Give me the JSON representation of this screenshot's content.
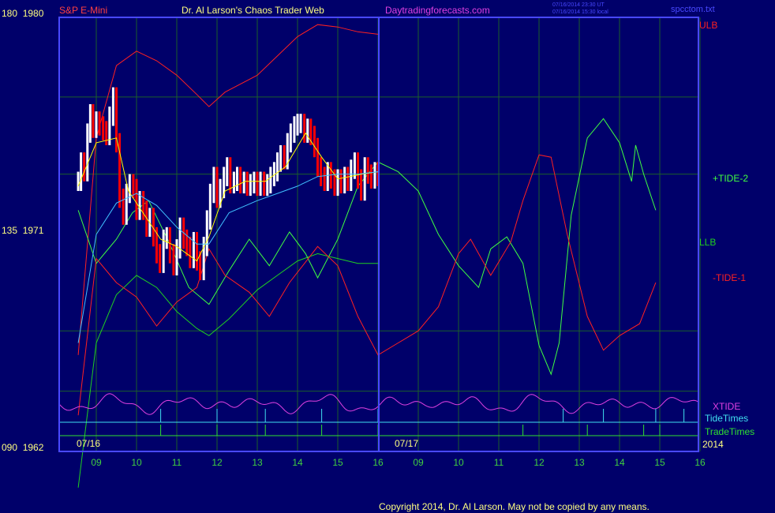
{
  "header": {
    "symbol": "S&P E-Mini",
    "site_title": "Dr. Al Larson's Chaos Trader Web",
    "site_link": "Daytradingforecasts.com",
    "timestamp_ut": "07/16/2014 23:30 UT",
    "timestamp_local": "07/16/2014 15:30 local",
    "file_name": "spcctom.txt"
  },
  "y_axis": {
    "top_label": "180  1980",
    "mid_label": "135  1971",
    "bottom_label": "090  1962"
  },
  "footer": {
    "date_left": "07/16",
    "date_mid": "07/17",
    "year": "2014",
    "copyright": "Copyright 2014, Dr. Al Larson. May not be copied by any means."
  },
  "legend": {
    "ulb": "ULB",
    "tide2": "+TIDE-2",
    "llb": "LLB",
    "tide1": "-TIDE-1",
    "xtide": "XTIDE",
    "tidetimes": "TideTimes",
    "tradetimes": "TradeTimes"
  },
  "colors": {
    "background": "#00006a",
    "frame": "#4848ff",
    "grid": "#1b5e2b",
    "price_up": "#ffffff",
    "price_down": "#ff0000",
    "ulb": "#ff2020",
    "llb": "#20d020",
    "tide2": "#40ff40",
    "tide1": "#ff2020",
    "xtide": "#e040e0",
    "tidetimes": "#40e0f0",
    "tradetimes": "#30e030",
    "ma_fast": "#ffff00",
    "ma_slow": "#40c0ff",
    "label_yellow": "#ffff80",
    "hour_labels": "#40d040",
    "title_blue": "#8080ff"
  },
  "chart_data": {
    "type": "line",
    "x_unit": "hour (Eastern)",
    "x_ticks": [
      {
        "day": "07/16",
        "hour": 9,
        "label": "09"
      },
      {
        "day": "07/16",
        "hour": 10,
        "label": "10"
      },
      {
        "day": "07/16",
        "hour": 11,
        "label": "11"
      },
      {
        "day": "07/16",
        "hour": 12,
        "label": "12"
      },
      {
        "day": "07/16",
        "hour": 13,
        "label": "13"
      },
      {
        "day": "07/16",
        "hour": 14,
        "label": "14"
      },
      {
        "day": "07/16",
        "hour": 15,
        "label": "15"
      },
      {
        "day": "07/16",
        "hour": 16,
        "label": "16"
      },
      {
        "day": "07/17",
        "hour": 9,
        "label": "09"
      },
      {
        "day": "07/17",
        "hour": 10,
        "label": "10"
      },
      {
        "day": "07/17",
        "hour": 11,
        "label": "11"
      },
      {
        "day": "07/17",
        "hour": 12,
        "label": "12"
      },
      {
        "day": "07/17",
        "hour": 13,
        "label": "13"
      },
      {
        "day": "07/17",
        "hour": 14,
        "label": "14"
      },
      {
        "day": "07/17",
        "hour": 15,
        "label": "15"
      },
      {
        "day": "07/17",
        "hour": 16,
        "label": "16"
      }
    ],
    "y_range": [
      1962,
      1980
    ],
    "y_ticks": [
      1962,
      1971,
      1980
    ],
    "price_bars": [
      [
        8.55,
        1973.2
      ],
      [
        8.62,
        1974.0
      ],
      [
        8.7,
        1973.6
      ],
      [
        8.78,
        1975.2
      ],
      [
        8.85,
        1976.0
      ],
      [
        8.92,
        1975.4
      ],
      [
        9.0,
        1975.7
      ],
      [
        9.08,
        1975.5
      ],
      [
        9.17,
        1975.3
      ],
      [
        9.25,
        1975.1
      ],
      [
        9.33,
        1975.9
      ],
      [
        9.42,
        1976.7
      ],
      [
        9.5,
        1974.8
      ],
      [
        9.58,
        1972.5
      ],
      [
        9.67,
        1971.8
      ],
      [
        9.75,
        1972.7
      ],
      [
        9.83,
        1973.1
      ],
      [
        9.92,
        1972.9
      ],
      [
        10.0,
        1972.0
      ],
      [
        10.08,
        1972.4
      ],
      [
        10.17,
        1972.0
      ],
      [
        10.25,
        1971.3
      ],
      [
        10.33,
        1971.7
      ],
      [
        10.42,
        1970.9
      ],
      [
        10.5,
        1970.2
      ],
      [
        10.58,
        1969.8
      ],
      [
        10.67,
        1970.8
      ],
      [
        10.75,
        1970.9
      ],
      [
        10.83,
        1970.2
      ],
      [
        10.92,
        1969.7
      ],
      [
        11.0,
        1970.4
      ],
      [
        11.08,
        1971.3
      ],
      [
        11.17,
        1970.8
      ],
      [
        11.25,
        1970.5
      ],
      [
        11.33,
        1970.0
      ],
      [
        11.42,
        1970.7
      ],
      [
        11.5,
        1969.9
      ],
      [
        11.58,
        1969.5
      ],
      [
        11.67,
        1970.5
      ],
      [
        11.75,
        1971.6
      ],
      [
        11.83,
        1972.7
      ],
      [
        11.92,
        1973.4
      ],
      [
        12.0,
        1972.5
      ],
      [
        12.08,
        1972.9
      ],
      [
        12.17,
        1973.4
      ],
      [
        12.25,
        1973.8
      ],
      [
        12.33,
        1973.1
      ],
      [
        12.42,
        1973.2
      ],
      [
        12.5,
        1973.4
      ],
      [
        12.58,
        1973.1
      ],
      [
        12.67,
        1973.2
      ],
      [
        12.75,
        1973.0
      ],
      [
        12.83,
        1973.1
      ],
      [
        12.92,
        1973.2
      ],
      [
        13.0,
        1973.0
      ],
      [
        13.08,
        1973.2
      ],
      [
        13.17,
        1973.0
      ],
      [
        13.25,
        1973.1
      ],
      [
        13.33,
        1973.4
      ],
      [
        13.42,
        1973.6
      ],
      [
        13.5,
        1974.0
      ],
      [
        13.58,
        1974.3
      ],
      [
        13.67,
        1974.1
      ],
      [
        13.75,
        1974.8
      ],
      [
        13.83,
        1975.2
      ],
      [
        13.92,
        1975.5
      ],
      [
        14.0,
        1975.6
      ],
      [
        14.08,
        1975.6
      ],
      [
        14.17,
        1975.2
      ],
      [
        14.25,
        1975.4
      ],
      [
        14.33,
        1975.1
      ],
      [
        14.42,
        1974.6
      ],
      [
        14.5,
        1973.8
      ],
      [
        14.58,
        1973.4
      ],
      [
        14.67,
        1973.2
      ],
      [
        14.75,
        1973.6
      ],
      [
        14.83,
        1973.3
      ],
      [
        14.92,
        1973.0
      ],
      [
        15.0,
        1973.3
      ],
      [
        15.08,
        1973.1
      ],
      [
        15.17,
        1973.4
      ],
      [
        15.25,
        1973.2
      ],
      [
        15.33,
        1973.7
      ],
      [
        15.42,
        1974.0
      ],
      [
        15.5,
        1973.3
      ],
      [
        15.58,
        1972.8
      ],
      [
        15.67,
        1973.8
      ],
      [
        15.75,
        1973.5
      ],
      [
        15.83,
        1973.3
      ],
      [
        15.92,
        1973.6
      ],
      [
        16.0,
        1973.4
      ]
    ],
    "series": [
      {
        "name": "ULB",
        "points": [
          [
            8.55,
            1966
          ],
          [
            9.0,
            1975
          ],
          [
            9.5,
            1978
          ],
          [
            10.0,
            1978.6
          ],
          [
            10.5,
            1978.2
          ],
          [
            11.0,
            1977.6
          ],
          [
            11.5,
            1976.8
          ],
          [
            11.8,
            1976.3
          ],
          [
            12.2,
            1976.9
          ],
          [
            13.0,
            1977.6
          ],
          [
            13.5,
            1978.4
          ],
          [
            14.0,
            1979.2
          ],
          [
            14.5,
            1979.7
          ],
          [
            15.0,
            1979.6
          ],
          [
            15.5,
            1979.4
          ],
          [
            16.0,
            1979.3
          ]
        ]
      },
      {
        "name": "LLB",
        "points": [
          [
            8.55,
            1960.5
          ],
          [
            9.0,
            1966.5
          ],
          [
            9.5,
            1968.5
          ],
          [
            10.0,
            1969.3
          ],
          [
            10.5,
            1968.8
          ],
          [
            11.0,
            1967.8
          ],
          [
            11.5,
            1967.1
          ],
          [
            11.8,
            1966.8
          ],
          [
            12.3,
            1967.5
          ],
          [
            13.0,
            1968.7
          ],
          [
            13.5,
            1969.3
          ],
          [
            14.0,
            1969.9
          ],
          [
            14.5,
            1970.2
          ],
          [
            15.0,
            1970.0
          ],
          [
            15.5,
            1969.8
          ],
          [
            16.0,
            1969.8
          ]
        ]
      },
      {
        "name": "+TIDE-2",
        "points": [
          [
            8.55,
            1972
          ],
          [
            9.0,
            1969.8
          ],
          [
            9.5,
            1970.8
          ],
          [
            9.9,
            1971.9
          ],
          [
            10.3,
            1972.4
          ],
          [
            10.8,
            1970.7
          ],
          [
            11.3,
            1968.8
          ],
          [
            11.8,
            1968.1
          ],
          [
            12.3,
            1969.5
          ],
          [
            12.8,
            1970.8
          ],
          [
            13.3,
            1969.7
          ],
          [
            13.8,
            1971.1
          ],
          [
            14.2,
            1970.2
          ],
          [
            14.5,
            1969.2
          ],
          [
            15.0,
            1970.8
          ],
          [
            15.5,
            1973.0
          ],
          [
            16.0,
            1974.0
          ],
          [
            16.5,
            1973.6
          ],
          [
            17.0,
            1972.8
          ],
          [
            17.5,
            1971.0
          ],
          [
            18.0,
            1969.7
          ],
          [
            18.5,
            1968.8
          ],
          [
            18.8,
            1970.4
          ],
          [
            19.2,
            1970.9
          ],
          [
            19.6,
            1969.8
          ],
          [
            20.0,
            1966.4
          ],
          [
            20.3,
            1965.2
          ],
          [
            20.5,
            1966.5
          ],
          [
            20.8,
            1971.8
          ],
          [
            21.2,
            1975.0
          ],
          [
            21.6,
            1975.8
          ],
          [
            22.0,
            1974.8
          ],
          [
            22.3,
            1973.2
          ],
          [
            22.4,
            1974.7
          ],
          [
            22.6,
            1973.5
          ],
          [
            22.9,
            1972.0
          ]
        ]
      },
      {
        "name": "-TIDE-1",
        "points": [
          [
            8.55,
            1963.5
          ],
          [
            9.0,
            1970.0
          ],
          [
            9.5,
            1969.0
          ],
          [
            10.0,
            1968.4
          ],
          [
            10.5,
            1967.2
          ],
          [
            11.0,
            1968.2
          ],
          [
            11.5,
            1968.8
          ],
          [
            11.8,
            1970.4
          ],
          [
            12.2,
            1969.3
          ],
          [
            12.8,
            1968.6
          ],
          [
            13.3,
            1967.6
          ],
          [
            13.8,
            1969.0
          ],
          [
            14.5,
            1970.5
          ],
          [
            15.0,
            1969.7
          ],
          [
            15.5,
            1967.6
          ],
          [
            16.0,
            1966.0
          ],
          [
            16.5,
            1966.5
          ],
          [
            17.0,
            1967.0
          ],
          [
            17.5,
            1968.0
          ],
          [
            18.0,
            1970.2
          ],
          [
            18.3,
            1970.8
          ],
          [
            18.8,
            1969.3
          ],
          [
            19.3,
            1970.7
          ],
          [
            19.6,
            1972.4
          ],
          [
            20.0,
            1974.3
          ],
          [
            20.3,
            1974.2
          ],
          [
            20.7,
            1971.0
          ],
          [
            21.2,
            1967.6
          ],
          [
            21.6,
            1966.2
          ],
          [
            22.0,
            1966.8
          ],
          [
            22.5,
            1967.3
          ],
          [
            22.9,
            1969.0
          ]
        ]
      }
    ],
    "moving_averages": [
      {
        "name": "fast",
        "points": [
          [
            8.55,
            1973.0
          ],
          [
            9.0,
            1974.8
          ],
          [
            9.5,
            1975.0
          ],
          [
            9.8,
            1972.8
          ],
          [
            10.2,
            1971.8
          ],
          [
            10.6,
            1970.8
          ],
          [
            11.0,
            1970.5
          ],
          [
            11.5,
            1969.9
          ],
          [
            11.8,
            1970.9
          ],
          [
            12.2,
            1972.8
          ],
          [
            12.7,
            1973.2
          ],
          [
            13.2,
            1973.2
          ],
          [
            13.7,
            1973.8
          ],
          [
            14.2,
            1975.2
          ],
          [
            14.6,
            1974.2
          ],
          [
            15.0,
            1973.3
          ],
          [
            15.6,
            1973.5
          ],
          [
            16.0,
            1973.6
          ]
        ]
      },
      {
        "name": "slow",
        "points": [
          [
            8.55,
            1966.5
          ],
          [
            9.0,
            1971.0
          ],
          [
            9.5,
            1972.3
          ],
          [
            10.0,
            1972.7
          ],
          [
            10.5,
            1972.2
          ],
          [
            11.0,
            1971.3
          ],
          [
            11.5,
            1970.6
          ],
          [
            11.8,
            1970.6
          ],
          [
            12.3,
            1971.9
          ],
          [
            13.0,
            1972.4
          ],
          [
            13.5,
            1972.7
          ],
          [
            14.0,
            1973.0
          ],
          [
            14.5,
            1973.4
          ],
          [
            15.0,
            1973.5
          ],
          [
            15.5,
            1973.5
          ],
          [
            16.0,
            1973.6
          ]
        ]
      }
    ],
    "xtide_note": "oscillator band near bottom",
    "tide_times": [
      10.6,
      12.0,
      13.2,
      14.6,
      16.0,
      20.6,
      21.6,
      22.9,
      23.6
    ],
    "trade_times": [
      10.6,
      12.0,
      13.2,
      14.6,
      16.0,
      19.6,
      21.2,
      22.6,
      23.0
    ]
  }
}
